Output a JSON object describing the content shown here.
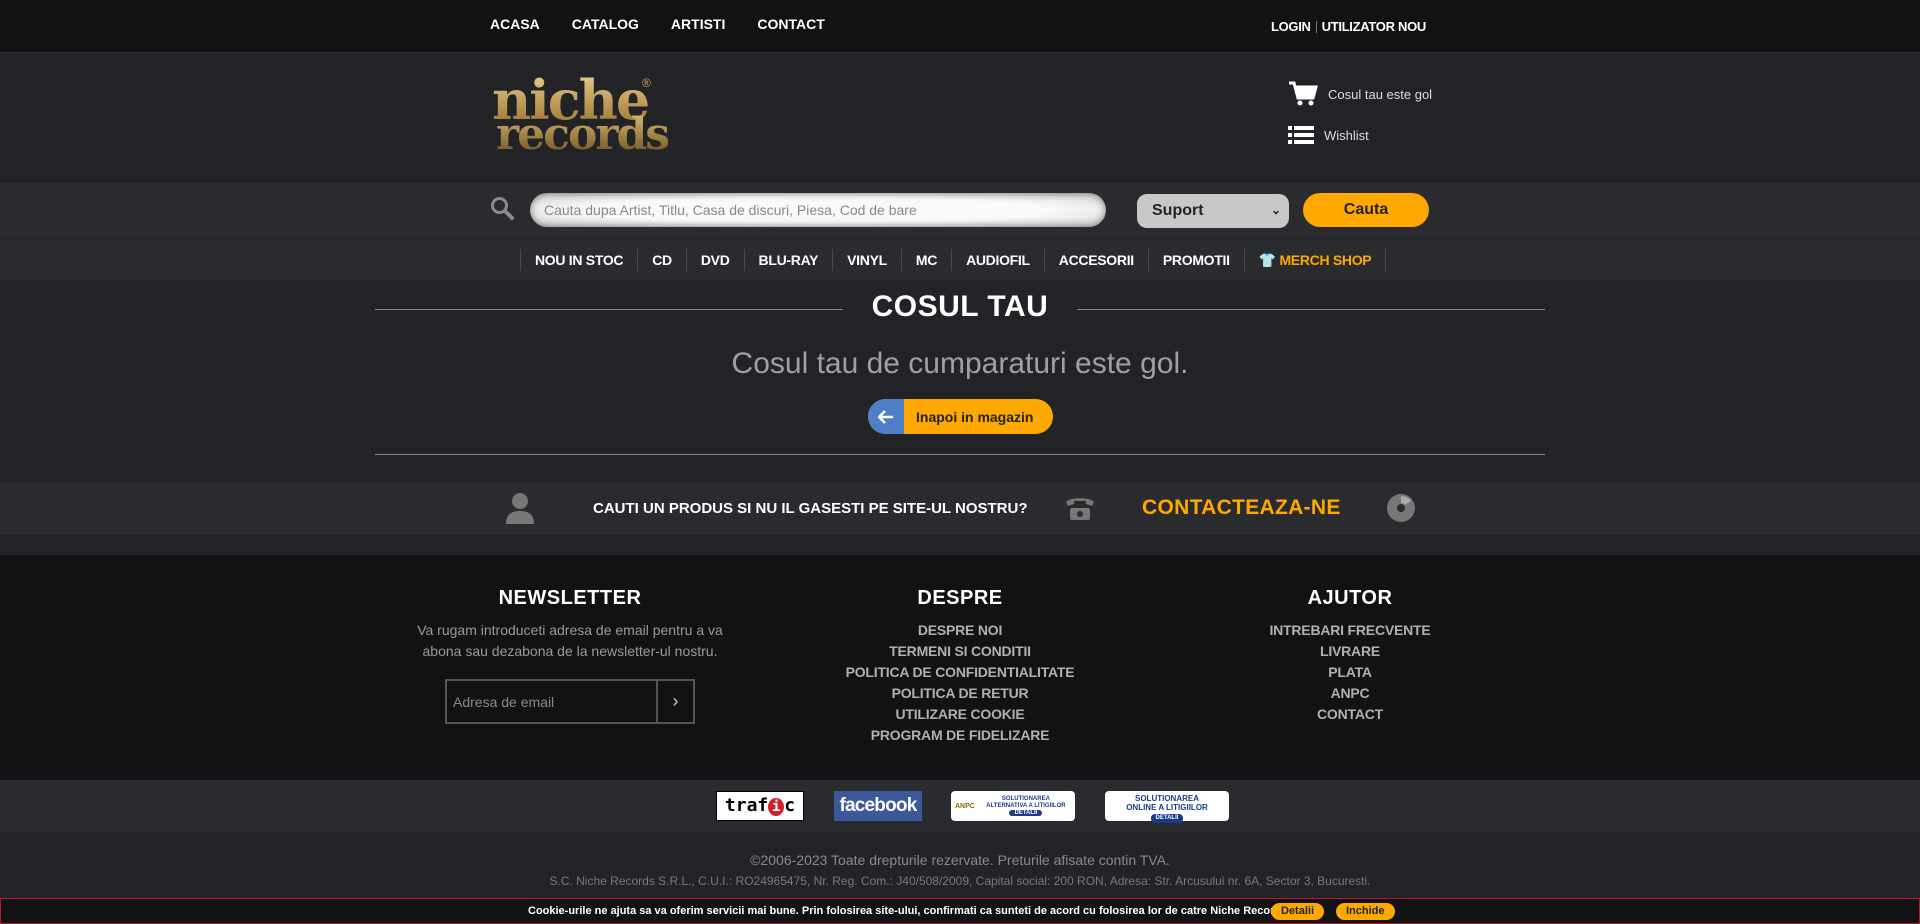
{
  "topnav": {
    "items": [
      "ACASA",
      "CATALOG",
      "ARTISTI",
      "CONTACT"
    ],
    "login": "LOGIN",
    "register": "UTILIZATOR NOU"
  },
  "header": {
    "logo_line1": "niche",
    "logo_line2": "records",
    "logo_reg": "®",
    "cart_label": "Cosul tau este gol",
    "wishlist_label": "Wishlist"
  },
  "search": {
    "placeholder": "Cauta dupa Artist, Titlu, Casa de discuri, Piesa, Cod de bare",
    "support_selected": "Suport",
    "button": "Cauta"
  },
  "categories": [
    "NOU IN STOC",
    "CD",
    "DVD",
    "BLU-RAY",
    "VINYL",
    "MC",
    "AUDIOFIL",
    "ACCESORII",
    "PROMOTII",
    "MERCH SHOP"
  ],
  "cart": {
    "title": "COSUL TAU",
    "empty_message": "Cosul tau de cumparaturi este gol.",
    "back_button": "Inapoi in magazin"
  },
  "contact_strip": {
    "question": "CAUTI UN PRODUS SI NU IL GASESTI PE SITE-UL NOSTRU?",
    "cta": "CONTACTEAZA-NE"
  },
  "footer": {
    "newsletter": {
      "title": "NEWSLETTER",
      "text": "Va rugam introduceti adresa de email pentru a va abona sau dezabona de la newsletter-ul nostru.",
      "email_placeholder": "Adresa de email",
      "submit": "›"
    },
    "despre": {
      "title": "DESPRE",
      "links": [
        "DESPRE NOI",
        "TERMENI SI CONDITII",
        "POLITICA DE CONFIDENTIALITATE",
        "POLITICA DE RETUR",
        "UTILIZARE COOKIE",
        "PROGRAM DE FIDELIZARE"
      ]
    },
    "ajutor": {
      "title": "AJUTOR",
      "links": [
        "INTREBARI FRECVENTE",
        "LIVRARE",
        "PLATA",
        "ANPC",
        "CONTACT"
      ]
    }
  },
  "badges": {
    "trafic_pre": "traf",
    "trafic_i": "i",
    "trafic_post": "c",
    "facebook": "facebook",
    "anpc1_brand": "ANPC",
    "anpc1_text": "SOLUTIONAREA ALTERNATIVA A LITIGIILOR",
    "anpc1_btn": "DETALII",
    "anpc2_text": "SOLUTIONAREA ONLINE A LITIGIILOR",
    "anpc2_btn": "DETALII"
  },
  "copyright": {
    "line1": "©2006-2023 Toate drepturile rezervate. Preturile afisate contin TVA.",
    "line2": "S.C. Niche Records S.R.L., C.U.I.: RO24965475, Nr. Reg. Com.: J40/508/2009, Capital social: 200 RON, Adresa: Str. Arcusului nr. 6A, Sector 3, Bucuresti."
  },
  "cookie": {
    "text": "Cookie-urile ne ajuta sa va oferim servicii mai bune. Prin folosirea site-ului, confirmati ca sunteti de acord cu folosirea lor de catre Niche Records.",
    "details": "Detalii",
    "close": "Inchide"
  },
  "colors": {
    "accent": "#ffa800",
    "back_arrow_bg": "#4f7fc4",
    "cookie_border": "#c0142a"
  }
}
